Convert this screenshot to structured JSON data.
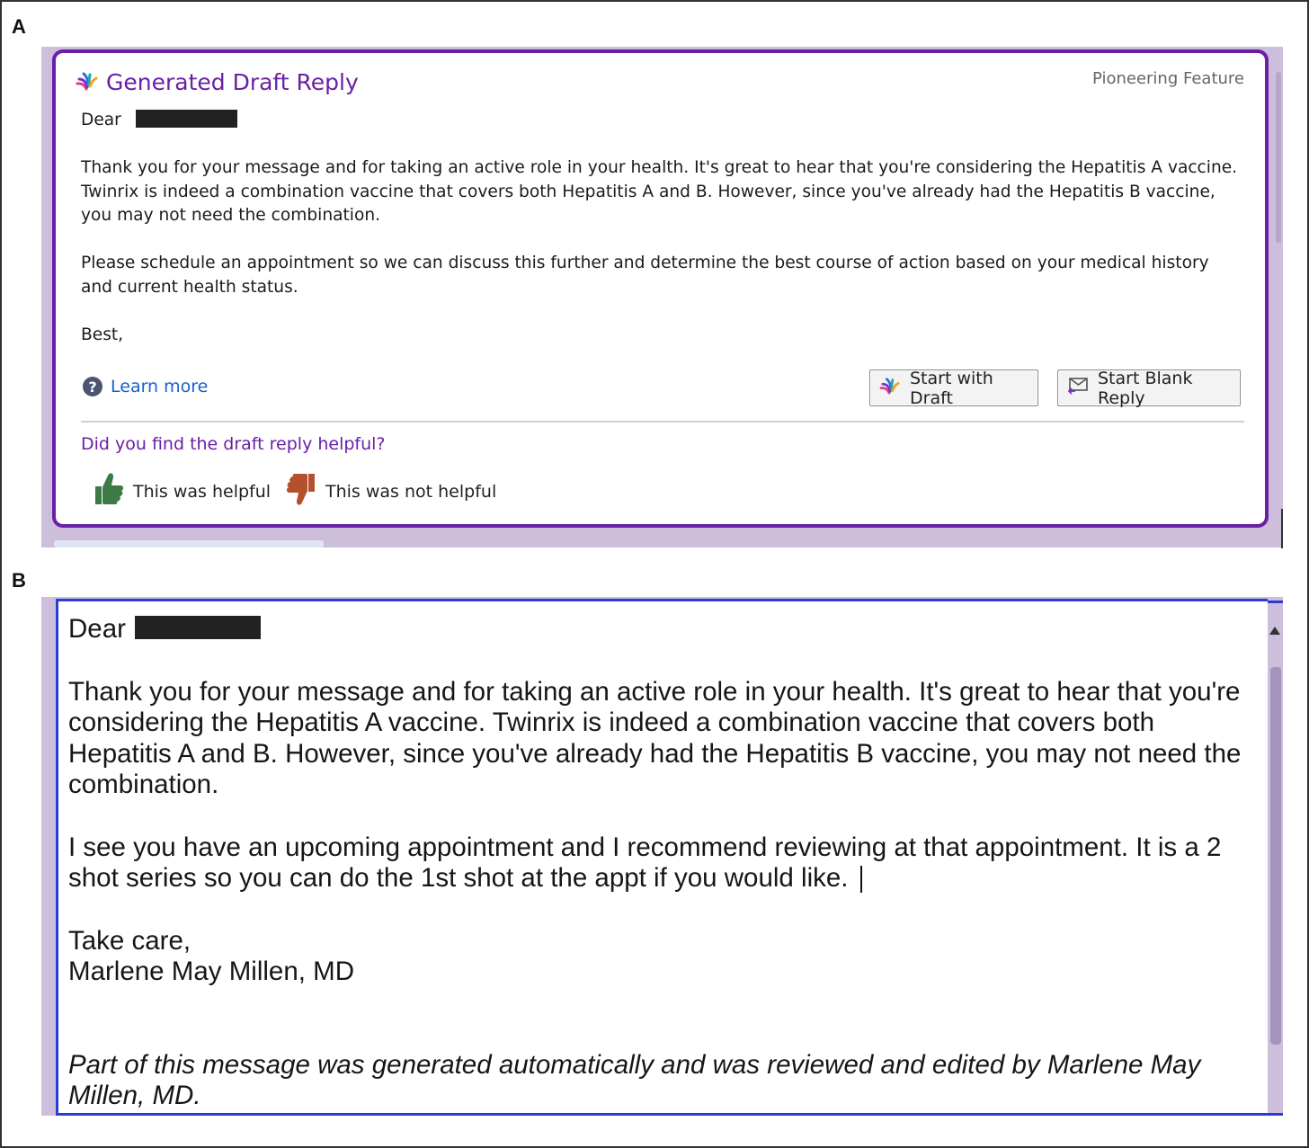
{
  "panels": {
    "a_label": "A",
    "b_label": "B"
  },
  "draft": {
    "title": "Generated Draft Reply",
    "badge": "Pioneering Feature",
    "greeting": "Dear",
    "paragraph1": "Thank you for your message and for taking an active role in your health. It's great to hear that you're considering the Hepatitis A vaccine. Twinrix is indeed a combination vaccine that covers both Hepatitis A and B. However, since you've already had the Hepatitis B vaccine, you may not need the combination.",
    "paragraph2": "Please schedule an appointment so we can discuss this further and determine the best course of action based on your medical history and current health status.",
    "closing": "Best,",
    "learn_more": "Learn more",
    "start_with_draft": "Start with Draft",
    "start_blank_reply": "Start Blank Reply",
    "feedback_question": "Did you find the draft reply helpful?",
    "helpful": "This was helpful",
    "not_helpful": "This was not helpful",
    "icons": {
      "sparkle": "sparkle-icon",
      "help": "question-circle-icon",
      "blank_reply": "reply-envelope-icon",
      "thumbs_up": "thumbs-up-icon",
      "thumbs_down": "thumbs-down-icon"
    }
  },
  "reply": {
    "greeting": "Dear",
    "paragraph1": "Thank you for your message and for taking an active role in your health. It's great to hear that you're considering the Hepatitis A vaccine. Twinrix is indeed a combination vaccine that covers both Hepatitis A and B. However, since you've already had the Hepatitis B vaccine, you may not need the combination.",
    "paragraph2": "I see you have an upcoming appointment and I recommend reviewing at that appointment. It is a 2 shot series so you can do the 1st shot at the appt if you would like.",
    "closing": "Take care,",
    "signature": "Marlene May Millen, MD",
    "disclaimer": "Part of this message was generated automatically and was reviewed and edited by Marlene May Millen, MD."
  },
  "colors": {
    "accent_purple": "#6a1fa6",
    "link_blue": "#1b5fcf",
    "editor_border_blue": "#2a3bd0",
    "panel_lavender": "#cdbfdc",
    "thumbs_up_green": "#3d7a45",
    "thumbs_down_rust": "#b4502e"
  }
}
